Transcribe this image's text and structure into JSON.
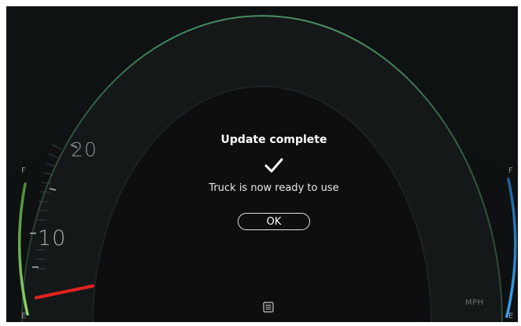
{
  "gauge": {
    "speed_labels": [
      "20",
      "10"
    ],
    "unit": "MPH",
    "fuel_gauge": {
      "full_label": "F",
      "empty_label": "E",
      "color": "#6fbf57"
    },
    "temp_gauge": {
      "full_label": "F",
      "empty_label": "E",
      "color": "#2f8fd6"
    },
    "needle_color": "#e0231e",
    "rim_color": "#3f8a5e"
  },
  "dialog": {
    "title": "Update complete",
    "icon": "checkmark-icon",
    "message": "Truck is now ready to use",
    "ok_label": "OK"
  },
  "footer": {
    "menu_icon": "menu-icon"
  }
}
